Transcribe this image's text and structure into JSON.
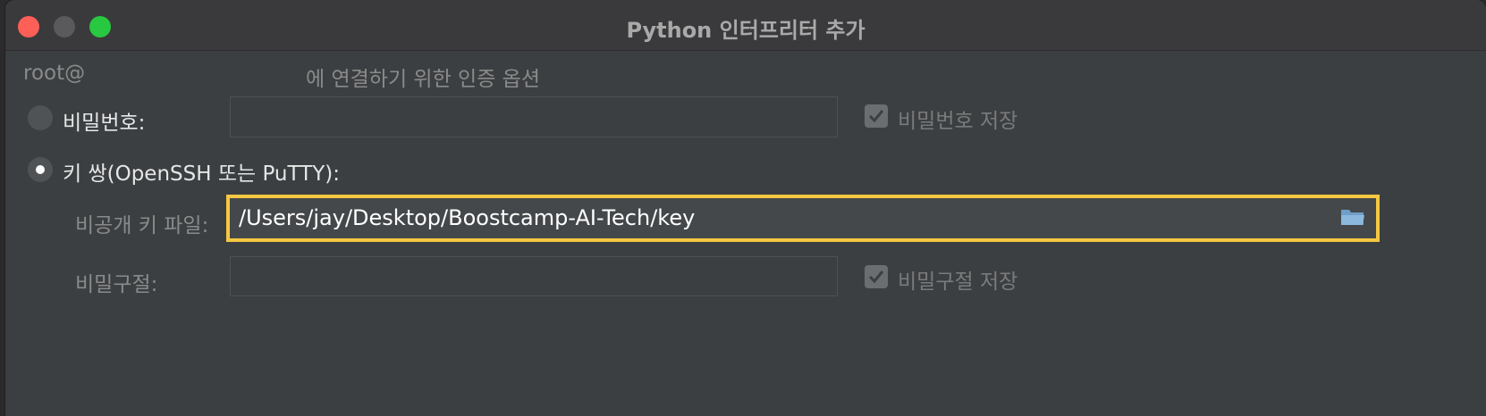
{
  "window": {
    "title": "Python 인터프리터 추가"
  },
  "auth": {
    "user_prefix": "root@",
    "header_suffix": "에 연결하기 위한 인증 옵션",
    "password_option_label": "비밀번호:",
    "key_pair_option_label": "키 쌍(OpenSSH 또는 PuTTY):",
    "selected_option": "key_pair",
    "save_password_label": "비밀번호 저장",
    "save_password_checked": true,
    "private_key_label": "비공개 키 파일:",
    "private_key_value": "/Users/jay/Desktop/Boostcamp-AI-Tech/key",
    "passphrase_label": "비밀구절:",
    "save_passphrase_label": "비밀구절 저장",
    "save_passphrase_checked": true
  },
  "colors": {
    "focus_border": "#f5c742",
    "close": "#fe5f57",
    "maximize": "#28c840"
  },
  "icons": {
    "browse": "folder-icon"
  }
}
